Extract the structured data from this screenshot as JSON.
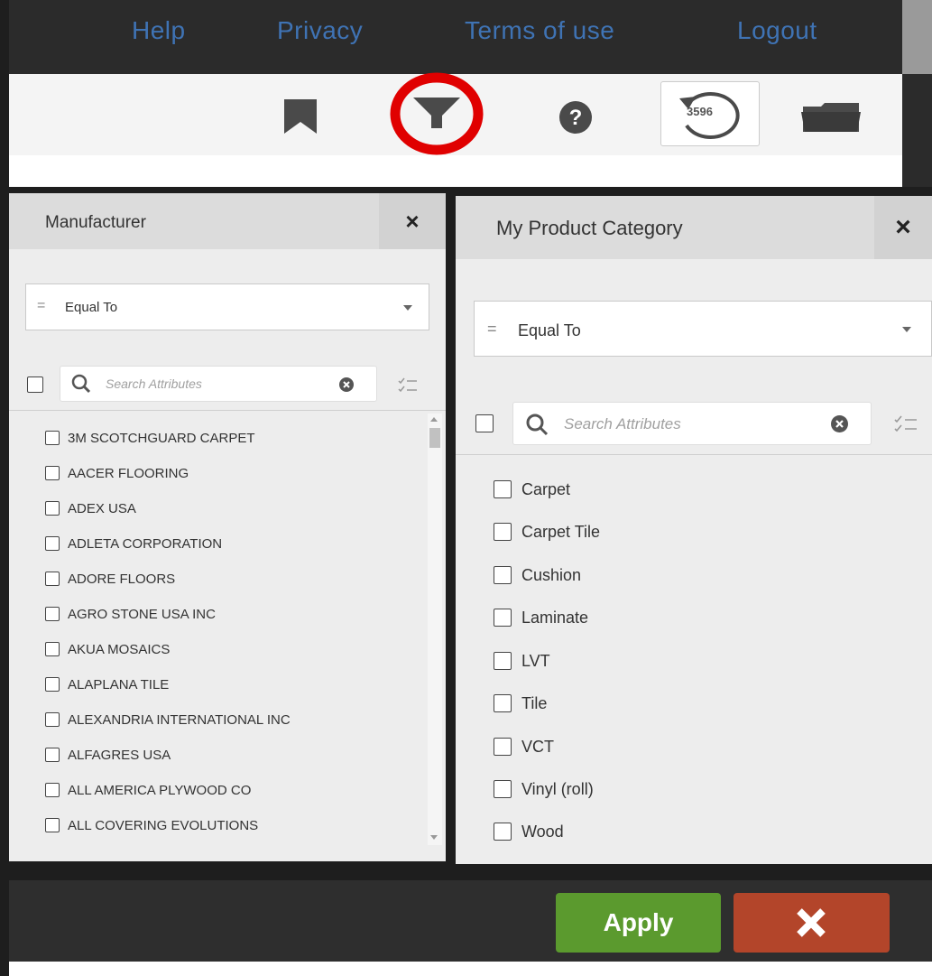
{
  "nav": {
    "links": [
      "Help",
      "Privacy",
      "Terms of use",
      "Logout"
    ]
  },
  "toolbar": {
    "icons": [
      "bookmark-icon",
      "filter-icon",
      "help-icon",
      "history-icon",
      "folder-icon"
    ],
    "history_count": "3596",
    "highlight_color": "#e00000"
  },
  "manufacturer": {
    "title": "Manufacturer",
    "close": "×",
    "operator_symbol": "=",
    "operator": "Equal To",
    "search_placeholder": "Search Attributes",
    "items": [
      "3M SCOTCHGUARD CARPET",
      "AACER FLOORING",
      "ADEX USA",
      "ADLETA CORPORATION",
      "ADORE FLOORS",
      "AGRO STONE USA INC",
      "AKUA MOSAICS",
      "ALAPLANA TILE",
      "ALEXANDRIA INTERNATIONAL INC",
      "ALFAGRES USA",
      "ALL AMERICA PLYWOOD CO",
      "ALL COVERING EVOLUTIONS"
    ]
  },
  "category": {
    "title": "My Product Category",
    "close": "×",
    "operator_symbol": "=",
    "operator": "Equal To",
    "search_placeholder": "Search Attributes",
    "items": [
      "Carpet",
      "Carpet Tile",
      "Cushion",
      "Laminate",
      "LVT",
      "Tile",
      "VCT",
      "Vinyl (roll)",
      "Wood"
    ]
  },
  "footer": {
    "apply_label": "Apply",
    "cancel_icon": "close-icon",
    "apply_color": "#5b9a2e",
    "cancel_color": "#b3452a"
  }
}
